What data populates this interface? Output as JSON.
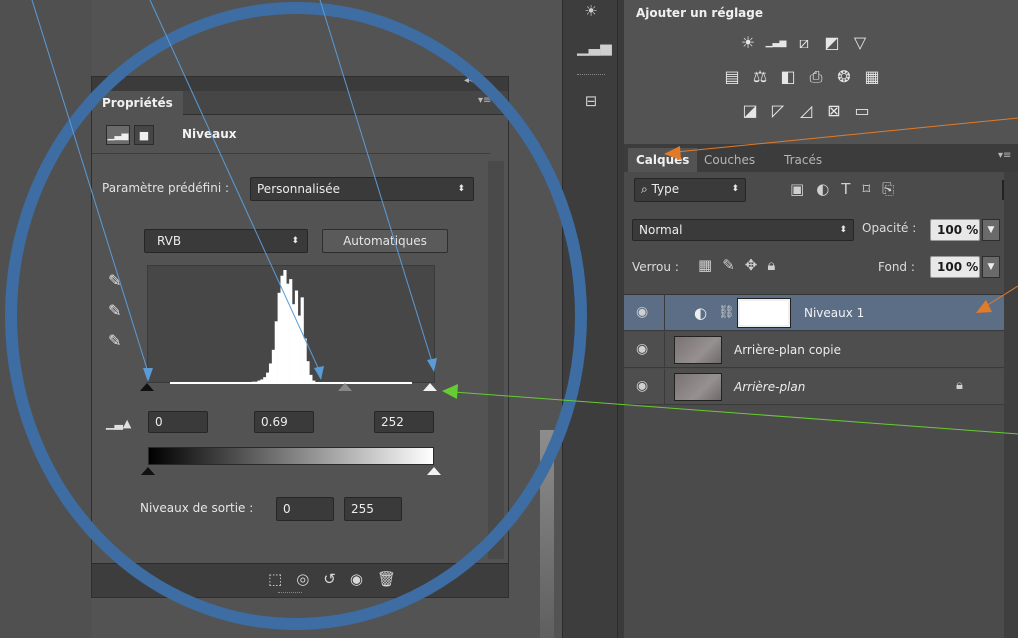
{
  "adjustments": {
    "title": "Ajouter un réglage",
    "icons": [
      [
        "brightness-icon",
        "levels-icon",
        "curves-icon",
        "exposure-icon",
        "vibrance-icon"
      ],
      [
        "hue-saturation-icon",
        "color-balance-icon",
        "black-white-icon",
        "photo-filter-icon",
        "channel-mixer-icon",
        "color-lookup-icon"
      ],
      [
        "invert-icon",
        "posterize-icon",
        "threshold-icon",
        "selective-color-icon",
        "gradient-map-icon"
      ]
    ]
  },
  "layers_panel": {
    "tabs": [
      "Calques",
      "Couches",
      "Tracés"
    ],
    "active_tab": "Calques",
    "filter_label": "Type",
    "blend_mode": "Normal",
    "opacity_label": "Opacité :",
    "opacity_value": "100 %",
    "lock_label": "Verrou :",
    "fill_label": "Fond :",
    "fill_value": "100 %",
    "layers": [
      {
        "name": "Niveaux 1",
        "selected": true,
        "italic": false,
        "locked": false
      },
      {
        "name": "Arrière-plan copie",
        "selected": false,
        "italic": false,
        "locked": false
      },
      {
        "name": "Arrière-plan",
        "selected": false,
        "italic": true,
        "locked": true
      }
    ]
  },
  "properties_panel": {
    "tab_label": "Propriétés",
    "adjustment_name": "Niveaux",
    "preset_label": "Paramètre prédéfini :",
    "preset_value": "Personnalisée",
    "channel_value": "RVB",
    "auto_button": "Automatiques",
    "input_black": "0",
    "input_gamma": "0.69",
    "input_white": "252",
    "output_label": "Niveaux de sortie :",
    "output_black": "0",
    "output_white": "255"
  },
  "histogram": {
    "bins": [
      0,
      0,
      0,
      0,
      0,
      0,
      0,
      0,
      0,
      0,
      0,
      0,
      0,
      0,
      0,
      0,
      0,
      0,
      0,
      0,
      0,
      0,
      0,
      0,
      0,
      0,
      0,
      0,
      0,
      0,
      0,
      0,
      0,
      0,
      0,
      1,
      2,
      2,
      3,
      4,
      6,
      10,
      18,
      30,
      55,
      80,
      95,
      100,
      88,
      92,
      70,
      82,
      60,
      76,
      40,
      20,
      8,
      3,
      1,
      0,
      0,
      0,
      0,
      0,
      0,
      0,
      0,
      0,
      0,
      0,
      0,
      0,
      0,
      0,
      0,
      0,
      0,
      0,
      0,
      0,
      0,
      0,
      0,
      0,
      0,
      0,
      0,
      0,
      0,
      0,
      0,
      0,
      0,
      0,
      0,
      0,
      0,
      0,
      0,
      0
    ],
    "black_point": 0,
    "gamma": 0.69,
    "white_point": 252
  },
  "colors": {
    "annotation_blue": "#5b9bd5",
    "annotation_orange": "#e07b2a",
    "annotation_green": "#66cc33",
    "circle": "#3d6da3",
    "selection": "#5b6e86"
  }
}
